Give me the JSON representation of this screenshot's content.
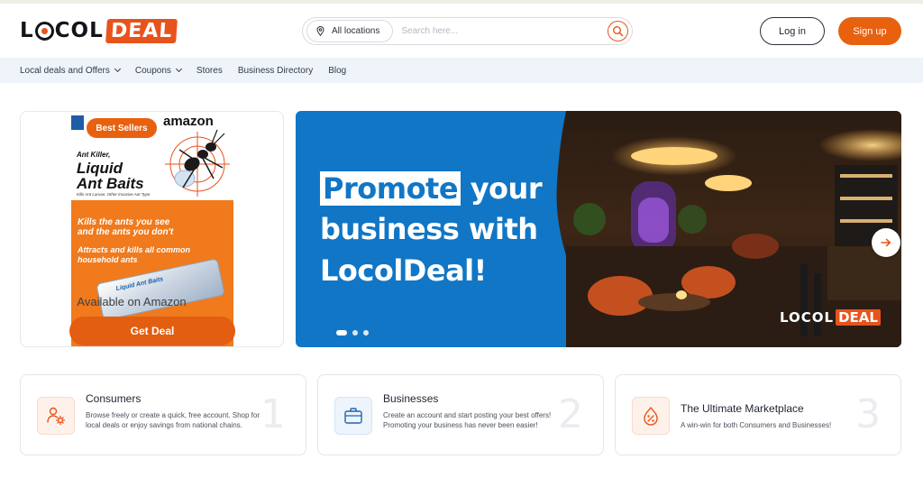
{
  "header": {
    "logo": {
      "locol_before_o": "L",
      "locol_after_o": "COL",
      "deal": "DEAL"
    },
    "location_label": "All locations",
    "search_placeholder": "Search here...",
    "login_label": "Log in",
    "signup_label": "Sign up"
  },
  "nav": {
    "items": [
      {
        "label": "Local deals and Offers",
        "dropdown": true
      },
      {
        "label": "Coupons",
        "dropdown": true
      },
      {
        "label": "Stores",
        "dropdown": false
      },
      {
        "label": "Business Directory",
        "dropdown": false
      },
      {
        "label": "Blog",
        "dropdown": false
      }
    ]
  },
  "product_card": {
    "badge": "Best Sellers",
    "image_texts": {
      "brand": "amazon",
      "ant_killer": "Ant Killer,",
      "title_line1": "Liquid",
      "title_line2": "Ant Baits",
      "fine_print": "Kills Ant Larvae, Other Invasive Ant Type",
      "kills_line1": "Kills the ants you see",
      "kills_line2": "and the ants you don't",
      "attracts_line1": "Attracts and kills all common",
      "attracts_line2": "household ants",
      "tray_label": "Liquid Ant Baits"
    },
    "availability": "Available on Amazon",
    "cta": "Get Deal"
  },
  "banner": {
    "headline_highlight": "Promote",
    "headline_rest_line1": " your",
    "headline_line2": "business with",
    "headline_line3": "LocolDeal!",
    "logo_locol": "LOCOL",
    "logo_deal": "DEAL",
    "slides_total": 3,
    "active_slide": 1
  },
  "features": [
    {
      "icon": "user-gear-icon",
      "title": "Consumers",
      "description": "Browse freely or create a quick, free account. Shop for local deals or enjoy savings from national chains.",
      "number": "1"
    },
    {
      "icon": "briefcase-icon",
      "title": "Businesses",
      "description": "Create an account and start posting your best offers! Promoting your business has never been easier!",
      "number": "2"
    },
    {
      "icon": "discount-tag-icon",
      "title": "The Ultimate Marketplace",
      "description": "A win-win for both Consumers and Businesses!",
      "number": "3"
    }
  ],
  "colors": {
    "brand_orange": "#e8610f",
    "banner_blue": "#1176c5",
    "nav_bg": "#eff4fb"
  }
}
